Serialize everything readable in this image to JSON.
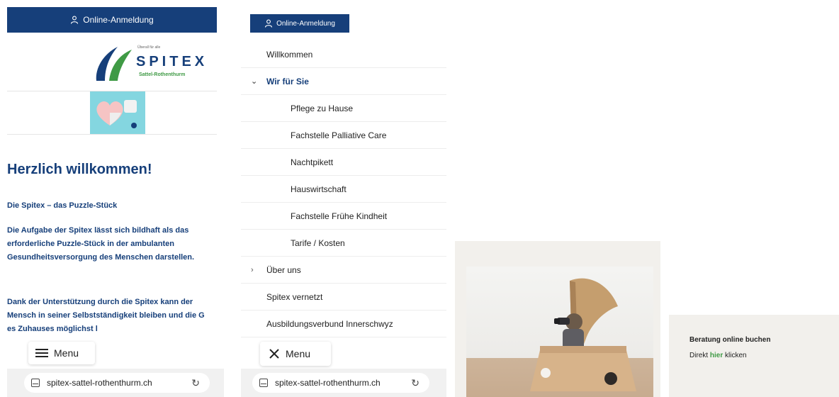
{
  "home": {
    "login_label": "Online-Anmeldung",
    "logo": {
      "tagline": "Überall für alle",
      "brand": "SPITEX",
      "sub": "Sattel-Rothenthurm"
    },
    "heading": "Herzlich willkommen!",
    "subheading": "Die Spitex – das Puzzle-Stück",
    "paragraph1": "Die Aufgabe der Spitex lässt sich bildhaft als das erforderliche  Puzzle-Stück in der ambulanten Gesundheitsversorgung des Menschen darstellen.",
    "paragraph2": "Dank der Unterstützung durch die Spitex kann der Mensch in seiner Selbstständigkeit bleiben und die G         es Zuhauses möglichst l",
    "menu_label": "Menu",
    "url": "spitex-sattel-rothenthurm.ch"
  },
  "nav": {
    "login_label": "Online-Anmeldung",
    "items": [
      {
        "label": "Willkommen"
      },
      {
        "label": "Wir für Sie"
      },
      {
        "label": "Pflege zu Hause"
      },
      {
        "label": "Fachstelle Palliative Care"
      },
      {
        "label": "Nachtpikett"
      },
      {
        "label": "Hauswirtschaft"
      },
      {
        "label": "Fachstelle Frühe Kindheit"
      },
      {
        "label": "Tarife / Kosten"
      },
      {
        "label": "Über uns"
      },
      {
        "label": "Spitex vernetzt"
      },
      {
        "label": "Ausbildungsverbund Innerschwyz"
      }
    ],
    "expand_chevron": "›",
    "collapse_chevron": "⌄",
    "close_label": "Menu",
    "url": "spitex-sattel-rothenthurm.ch"
  },
  "booking": {
    "title": "Beratung online buchen",
    "text_before": "Direkt ",
    "link": "hier",
    "text_after": " klicken"
  },
  "colors": {
    "brand_blue": "#163f7a",
    "brand_green": "#3f9a45",
    "panel_beige": "#f2f0ec"
  },
  "icons": {
    "login": "person-icon",
    "menu": "hamburger-icon",
    "close": "close-icon",
    "tab": "tab-icon",
    "reload": "reload-icon"
  }
}
